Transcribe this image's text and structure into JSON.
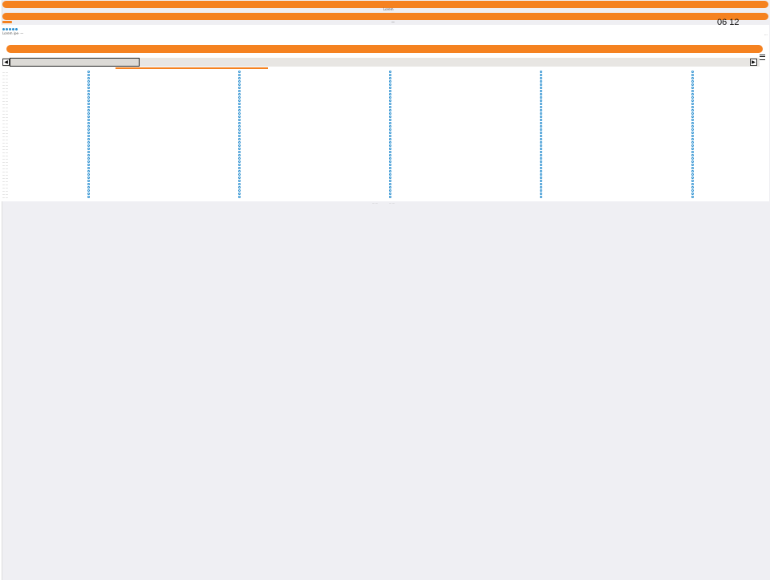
{
  "header": {
    "title_center": "Lorem",
    "small_center_text": "—",
    "clock": "06 12",
    "corner_text": "..."
  },
  "toolbar": {
    "status_label": "Lorem ips",
    "status_sub": "— —",
    "rating_count": 5
  },
  "scrollbar": {
    "left_arrow": "◀",
    "right_arrow": "▶"
  },
  "grid": {
    "row_label": "— —",
    "row_count": 40,
    "column_count": 5
  },
  "footer": {
    "left": "— —",
    "right": "— —"
  },
  "colors": {
    "accent": "#f58220",
    "dot": "#2a8fd0",
    "background": "#efeff3"
  }
}
